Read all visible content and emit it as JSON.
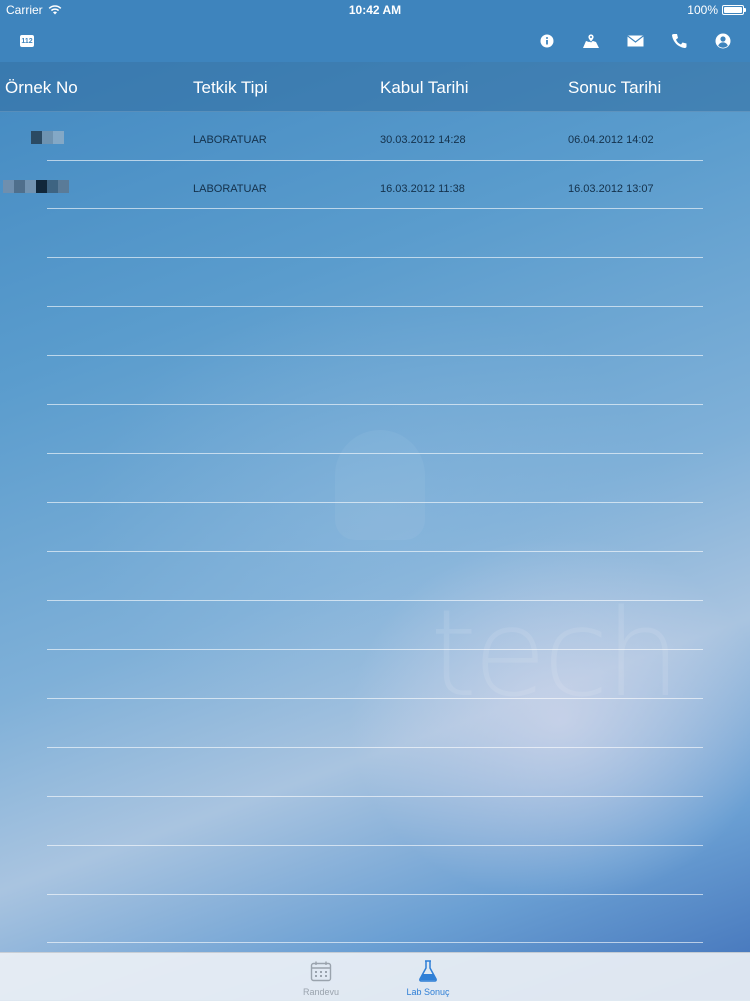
{
  "status_bar": {
    "carrier": "Carrier",
    "time": "10:42 AM",
    "battery": "100%"
  },
  "nav_bar": {
    "emergency_badge": "112"
  },
  "table": {
    "headers": [
      "Örnek No",
      "Tetkik Tipi",
      "Kabul Tarihi",
      "Sonuc Tarihi"
    ],
    "rows": [
      {
        "tetkik_tipi": "LABORATUAR",
        "kabul_tarihi": "30.03.2012 14:28",
        "sonuc_tarihi": "06.04.2012 14:02"
      },
      {
        "tetkik_tipi": "LABORATUAR",
        "kabul_tarihi": "16.03.2012 11:38",
        "sonuc_tarihi": "16.03.2012 13:07"
      }
    ]
  },
  "watermark_text": "tech",
  "tab_bar": {
    "tabs": [
      {
        "label": "Randevu",
        "icon": "calendar-icon",
        "color": "#9aa3ad"
      },
      {
        "label": "Lab Sonuç",
        "icon": "flask-icon",
        "color": "#2f7fd6"
      }
    ]
  },
  "colors": {
    "nav_bg": "#3e84bd",
    "accent": "#2f7fd6"
  }
}
